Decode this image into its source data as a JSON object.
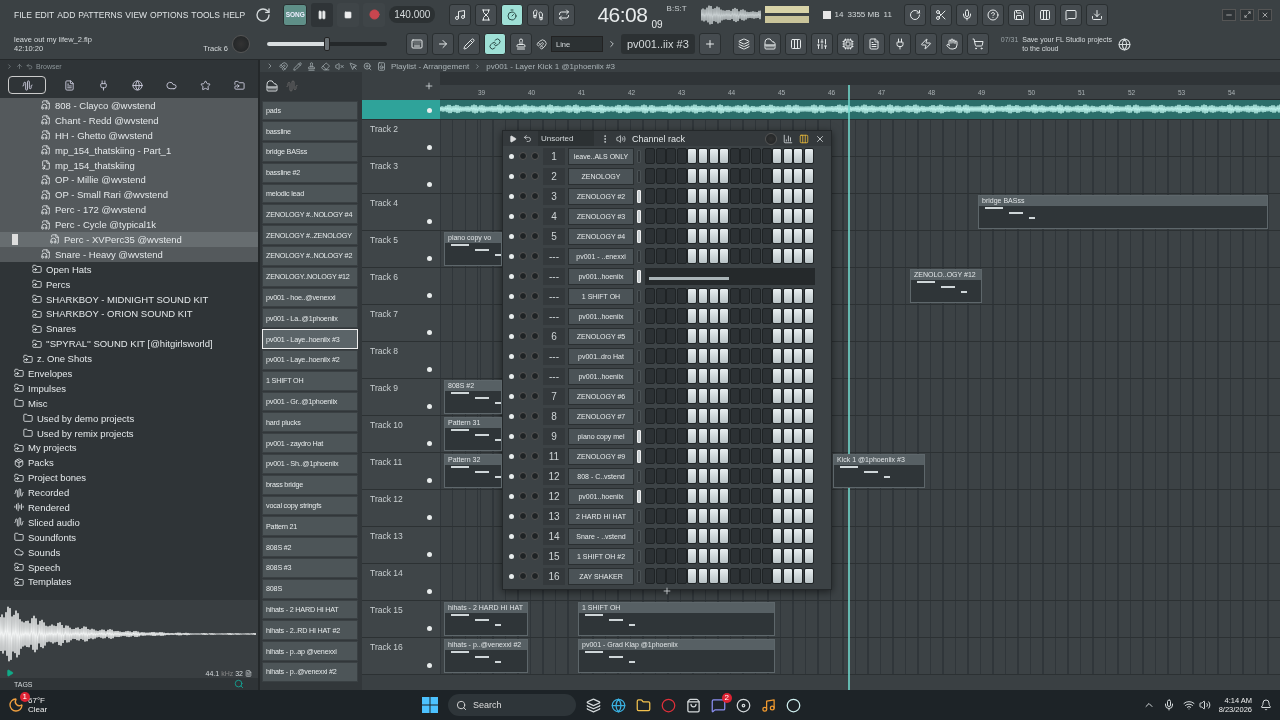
{
  "menu": [
    "FILE",
    "EDIT",
    "ADD",
    "PATTERNS",
    "VIEW",
    "OPTIONS",
    "TOOLS",
    "HELP"
  ],
  "project": {
    "file": "leave out my lifew_2.flp",
    "time": "42:10:20",
    "track": "Track 6"
  },
  "transport": {
    "mode": "SONG",
    "song_selected": true,
    "playing": true,
    "recording": false,
    "tempo": "140.000"
  },
  "master_volume": {
    "level": 0.5
  },
  "toggles": [
    {
      "kind": "metronome",
      "on": false
    },
    {
      "kind": "wait",
      "on": false
    },
    {
      "kind": "countdown",
      "on": true
    },
    {
      "kind": "step",
      "on": false
    },
    {
      "kind": "loop",
      "on": false
    }
  ],
  "clock": {
    "time": "46:08",
    "ticks": "09",
    "unit": "B:S:T"
  },
  "cpu": {
    "voices": "14",
    "memory": "3355 MB",
    "polyphony": "11"
  },
  "tools": [
    {
      "kind": "keyboard",
      "on": false
    },
    {
      "kind": "arrow",
      "on": false
    },
    {
      "kind": "pencil",
      "on": false
    },
    {
      "kind": "link",
      "on": true
    },
    {
      "kind": "stamp",
      "on": false
    }
  ],
  "snap": "Line",
  "pattern": "pv001..iix #3",
  "hint": {
    "counter": "07/31",
    "text": "Save your FL Studio projects to the cloud"
  },
  "browser": {
    "title": "Browser",
    "tabs": [
      {
        "kind": "all",
        "selected": true
      },
      {
        "kind": "files",
        "selected": false
      },
      {
        "kind": "plugins",
        "selected": false
      },
      {
        "kind": "online",
        "selected": false
      },
      {
        "kind": "cloud",
        "selected": false
      },
      {
        "kind": "favorites",
        "selected": false
      },
      {
        "kind": "folders",
        "selected": false
      }
    ],
    "tree": [
      {
        "children": [
          {
            "children": [
              {
                "children": [
                  {
                    "label": "808 - Clayco @wvstend",
                    "kind": "audio",
                    "selected": false
                  },
                  {
                    "label": "Chant - Redd @wvstend",
                    "kind": "audio",
                    "selected": false
                  },
                  {
                    "label": "HH - Ghetto @wvstend",
                    "kind": "audio",
                    "selected": false
                  },
                  {
                    "label": "mp_154_thatskiing - Part_1",
                    "kind": "audio",
                    "selected": false
                  },
                  {
                    "label": "mp_154_thatskiing",
                    "kind": "mp3",
                    "selected": false
                  },
                  {
                    "label": "OP - Millie @wvstend",
                    "kind": "audio",
                    "selected": false
                  },
                  {
                    "label": "OP - Small Rari @wvstend",
                    "kind": "audio",
                    "selected": false
                  },
                  {
                    "label": "Perc - 172 @wvstend",
                    "kind": "audio",
                    "selected": false
                  },
                  {
                    "label": "Perc - Cycle @typical1k",
                    "kind": "audio",
                    "selected": false,
                    "children": [
                      {
                        "label": "Perc - XVPerc35 @wvstend",
                        "kind": "audio",
                        "selected": true
                      }
                    ]
                  },
                  {
                    "label": "Snare - Heavy @wvstend",
                    "kind": "audio",
                    "selected": false
                  }
                ]
              },
              {
                "label": "Open Hats",
                "kind": "folder-link",
                "selected": false
              },
              {
                "label": "Percs",
                "kind": "folder-link",
                "selected": false
              },
              {
                "label": "SHARKBOY - MIDNIGHT SOUND KIT",
                "kind": "folder-link",
                "selected": false
              },
              {
                "label": "SHARKBOY - ORION SOUND KIT",
                "kind": "folder-link",
                "selected": false
              },
              {
                "label": "Snares",
                "kind": "folder-link",
                "selected": false
              },
              {
                "label": "''SPYRAL'' SOUND KIT [@hitgirlsworld]",
                "kind": "folder-link",
                "selected": false
              }
            ]
          },
          {
            "label": "z. One Shots",
            "kind": "folder-link",
            "selected": false
          }
        ]
      },
      {
        "label": "Envelopes",
        "kind": "folder-link",
        "selected": false
      },
      {
        "label": "Impulses",
        "kind": "folder-link",
        "selected": false
      },
      {
        "label": "Misc",
        "kind": "folder",
        "selected": false,
        "children": [
          {
            "label": "Used by demo projects",
            "kind": "folder",
            "selected": false
          },
          {
            "label": "Used by remix projects",
            "kind": "folder",
            "selected": false
          }
        ]
      },
      {
        "label": "My projects",
        "kind": "folder-link",
        "selected": false
      },
      {
        "label": "Packs",
        "kind": "packs",
        "selected": false
      },
      {
        "label": "Project bones",
        "kind": "folder-link",
        "selected": false
      },
      {
        "label": "Recorded",
        "kind": "wave",
        "selected": false
      },
      {
        "label": "Rendered",
        "kind": "rendered",
        "selected": false
      },
      {
        "label": "Sliced audio",
        "kind": "wave",
        "selected": false
      },
      {
        "label": "Soundfonts",
        "kind": "folder",
        "selected": false
      },
      {
        "label": "Sounds",
        "kind": "cloud",
        "selected": false
      },
      {
        "label": "Speech",
        "kind": "folder-link",
        "selected": false
      },
      {
        "label": "Templates",
        "kind": "folder-link",
        "selected": false
      }
    ],
    "sample_rate": "44.1",
    "sample_unit": "kHz",
    "bit_depth": "32",
    "tags": "TAGS"
  },
  "playlist": {
    "title": "Playlist - Arrangement",
    "pattern": "pv001 - Layer Kick 1 @1phoeniix #3",
    "ruler": [
      "39",
      "40",
      "41",
      "42",
      "43",
      "44",
      "45",
      "46",
      "47",
      "48",
      "49",
      "50",
      "51",
      "52",
      "53",
      "54"
    ],
    "patterns": [
      {
        "label": "pads",
        "selected": false
      },
      {
        "label": "bassline",
        "selected": false
      },
      {
        "label": "bridge BASss",
        "selected": false
      },
      {
        "label": "bassline #2",
        "selected": false
      },
      {
        "label": "melodic lead",
        "selected": false
      },
      {
        "label": "ZENOLOGY #..NOLOGY #4",
        "selected": false
      },
      {
        "label": "ZENOLOGY #..ZENOLOGY",
        "selected": false
      },
      {
        "label": "ZENOLOGY #..NOLOGY #2",
        "selected": false
      },
      {
        "label": "ZENOLOGY..NOLOGY #12",
        "selected": false
      },
      {
        "label": "pv001 - hoe..@venexxi",
        "selected": false
      },
      {
        "label": "pv001 - La..@1phoeniix",
        "selected": false
      },
      {
        "label": "pv001 - Laye..hoeniix #3",
        "selected": true
      },
      {
        "label": "pv001 - Laye..hoeniix #2",
        "selected": false
      },
      {
        "label": "1 SHIFT OH",
        "selected": false
      },
      {
        "label": "pv001 - Gr..@1phoeniix",
        "selected": false
      },
      {
        "label": "hard plucks",
        "selected": false
      },
      {
        "label": "pv001 - zaydro Hat",
        "selected": false
      },
      {
        "label": "pv001 - Sh..@1phoeniix",
        "selected": false
      },
      {
        "label": "brass bridge",
        "selected": false
      },
      {
        "label": "vocal copy stringfs",
        "selected": false
      },
      {
        "label": "Pattern 21",
        "selected": false
      },
      {
        "label": "808S #2",
        "selected": false
      },
      {
        "label": "808S #3",
        "selected": false
      },
      {
        "label": "808S",
        "selected": false
      },
      {
        "label": "hihats - 2 HARD HI HAT",
        "selected": false
      },
      {
        "label": "hihats - 2..RD HI HAT #2",
        "selected": false
      },
      {
        "label": "hihats - p..ap @venexxi",
        "selected": false
      },
      {
        "label": "hihats - p..@venexxi #2",
        "selected": false
      }
    ],
    "tracks": [
      {
        "kind": "audio"
      },
      {
        "kind": "pattern",
        "label": "Track 2"
      },
      {
        "kind": "pattern",
        "label": "Track 3"
      },
      {
        "kind": "pattern",
        "label": "Track 4",
        "clips": [
          "bridge BASss"
        ]
      },
      {
        "kind": "pattern",
        "label": "Track 5",
        "clips": [
          "piano copy vo"
        ]
      },
      {
        "kind": "pattern",
        "label": "Track 6",
        "clips": [
          "ZENOLO..OGY #12"
        ]
      },
      {
        "kind": "pattern",
        "label": "Track 7"
      },
      {
        "kind": "pattern",
        "label": "Track 8"
      },
      {
        "kind": "pattern",
        "label": "Track 9",
        "clips": [
          "808S #2"
        ]
      },
      {
        "kind": "pattern",
        "label": "Track 10",
        "clips": [
          "Pattern 31"
        ]
      },
      {
        "kind": "pattern",
        "label": "Track 11",
        "clips": [
          "Pattern 32",
          "Kick 1 @1phoeniix #3"
        ]
      },
      {
        "kind": "pattern",
        "label": "Track 12"
      },
      {
        "kind": "pattern",
        "label": "Track 13"
      },
      {
        "kind": "pattern",
        "label": "Track 14"
      },
      {
        "kind": "pattern",
        "label": "Track 15",
        "clips": [
          "hihats - 2 HARD HI HAT",
          "1 SHIFT OH"
        ]
      },
      {
        "kind": "pattern",
        "label": "Track 16",
        "clips": [
          "hihats - p..@venexxi #2",
          "pv001 - Grad Klap @1phoeniix"
        ]
      }
    ]
  },
  "rack": {
    "title": "Channel rack",
    "filter": "Unsorted",
    "channels": [
      {
        "number": "1",
        "name": "leave..ALS ONLY",
        "selected": false,
        "kind": "steps",
        "steps": [
          false,
          false,
          false,
          false,
          true,
          true,
          true,
          true,
          false,
          false,
          false,
          false,
          true,
          true,
          true,
          true
        ]
      },
      {
        "number": "2",
        "name": "ZENOLOGY",
        "selected": false,
        "kind": "steps",
        "steps": [
          false,
          false,
          false,
          false,
          true,
          true,
          true,
          true,
          false,
          false,
          false,
          false,
          true,
          true,
          true,
          true
        ]
      },
      {
        "number": "3",
        "name": "ZENOLOGY #2",
        "selected": true,
        "kind": "steps",
        "steps": [
          false,
          false,
          false,
          false,
          true,
          true,
          true,
          true,
          false,
          false,
          false,
          false,
          true,
          true,
          true,
          true
        ]
      },
      {
        "number": "4",
        "name": "ZENOLOGY #3",
        "selected": true,
        "kind": "steps",
        "steps": [
          false,
          false,
          false,
          false,
          true,
          true,
          true,
          true,
          false,
          false,
          false,
          false,
          true,
          true,
          true,
          true
        ]
      },
      {
        "number": "5",
        "name": "ZENOLOGY #4",
        "selected": true,
        "kind": "steps",
        "steps": [
          false,
          false,
          false,
          false,
          true,
          true,
          true,
          true,
          false,
          false,
          false,
          false,
          true,
          true,
          true,
          true
        ]
      },
      {
        "number": "---",
        "name": "pv001 - ..enexxi",
        "selected": false,
        "kind": "steps",
        "steps": [
          false,
          false,
          false,
          false,
          true,
          true,
          true,
          true,
          false,
          false,
          false,
          false,
          true,
          true,
          true,
          true
        ]
      },
      {
        "number": "---",
        "name": "pv001..hoeniix",
        "selected": true,
        "kind": "roll"
      },
      {
        "number": "---",
        "name": "1 SHIFT OH",
        "selected": false,
        "kind": "steps",
        "steps": [
          false,
          false,
          false,
          false,
          true,
          true,
          true,
          true,
          false,
          false,
          false,
          false,
          true,
          true,
          true,
          true
        ]
      },
      {
        "number": "---",
        "name": "pv001..hoeniix",
        "selected": false,
        "kind": "steps",
        "steps": [
          false,
          false,
          false,
          false,
          true,
          true,
          true,
          true,
          false,
          false,
          false,
          false,
          true,
          true,
          true,
          true
        ]
      },
      {
        "number": "6",
        "name": "ZENOLOGY #5",
        "selected": false,
        "kind": "steps",
        "steps": [
          false,
          false,
          false,
          false,
          true,
          true,
          true,
          true,
          false,
          false,
          false,
          false,
          true,
          true,
          true,
          true
        ]
      },
      {
        "number": "---",
        "name": "pv001..dro Hat",
        "selected": false,
        "kind": "steps",
        "steps": [
          false,
          false,
          false,
          false,
          true,
          true,
          true,
          true,
          false,
          false,
          false,
          false,
          true,
          true,
          true,
          true
        ]
      },
      {
        "number": "---",
        "name": "pv001..hoeniix",
        "selected": false,
        "kind": "steps",
        "steps": [
          false,
          false,
          false,
          false,
          true,
          true,
          true,
          true,
          false,
          false,
          false,
          false,
          true,
          true,
          true,
          true
        ]
      },
      {
        "number": "7",
        "name": "ZENOLOGY #6",
        "selected": false,
        "kind": "steps",
        "steps": [
          false,
          false,
          false,
          false,
          true,
          true,
          true,
          true,
          false,
          false,
          false,
          false,
          true,
          true,
          true,
          true
        ]
      },
      {
        "number": "8",
        "name": "ZENOLOGY #7",
        "selected": false,
        "kind": "steps",
        "steps": [
          false,
          false,
          false,
          false,
          true,
          true,
          true,
          true,
          false,
          false,
          false,
          false,
          true,
          true,
          true,
          true
        ]
      },
      {
        "number": "9",
        "name": "piano copy mel",
        "selected": true,
        "kind": "steps",
        "steps": [
          false,
          false,
          false,
          false,
          true,
          true,
          true,
          true,
          false,
          false,
          false,
          false,
          true,
          true,
          true,
          true
        ]
      },
      {
        "number": "11",
        "name": "ZENOLOGY #9",
        "selected": true,
        "kind": "steps",
        "steps": [
          false,
          false,
          false,
          false,
          true,
          true,
          true,
          true,
          false,
          false,
          false,
          false,
          true,
          true,
          true,
          true
        ]
      },
      {
        "number": "12",
        "name": "808 - C..vstend",
        "selected": false,
        "kind": "steps",
        "steps": [
          false,
          false,
          false,
          false,
          true,
          true,
          true,
          true,
          false,
          false,
          false,
          false,
          true,
          true,
          true,
          true
        ]
      },
      {
        "number": "12",
        "name": "pv001..hoeniix",
        "selected": true,
        "kind": "steps",
        "steps": [
          false,
          false,
          false,
          false,
          true,
          true,
          true,
          true,
          false,
          false,
          false,
          false,
          true,
          true,
          true,
          true
        ]
      },
      {
        "number": "13",
        "name": "2 HARD HI HAT",
        "selected": false,
        "kind": "steps",
        "steps": [
          false,
          false,
          false,
          false,
          true,
          true,
          true,
          true,
          false,
          false,
          false,
          false,
          true,
          true,
          true,
          true
        ]
      },
      {
        "number": "14",
        "name": "Snare - ..vstend",
        "selected": false,
        "kind": "steps",
        "steps": [
          false,
          false,
          false,
          false,
          true,
          true,
          true,
          true,
          false,
          false,
          false,
          false,
          true,
          true,
          true,
          true
        ]
      },
      {
        "number": "15",
        "name": "1 SHIFT OH #2",
        "selected": false,
        "kind": "steps",
        "steps": [
          false,
          false,
          false,
          false,
          true,
          true,
          true,
          true,
          false,
          false,
          false,
          false,
          true,
          true,
          true,
          true
        ]
      },
      {
        "number": "16",
        "name": "ZAY SHAKER",
        "selected": false,
        "kind": "steps",
        "steps": [
          false,
          false,
          false,
          false,
          true,
          true,
          true,
          true,
          false,
          false,
          false,
          false,
          true,
          true,
          true,
          true
        ]
      }
    ]
  },
  "taskbar": {
    "weather": {
      "badge": "1",
      "temp": "67°F",
      "condition": "Clear"
    },
    "search": "Search",
    "chat_badge": "2",
    "time": "4:14 AM",
    "date": "8/23/2026"
  }
}
